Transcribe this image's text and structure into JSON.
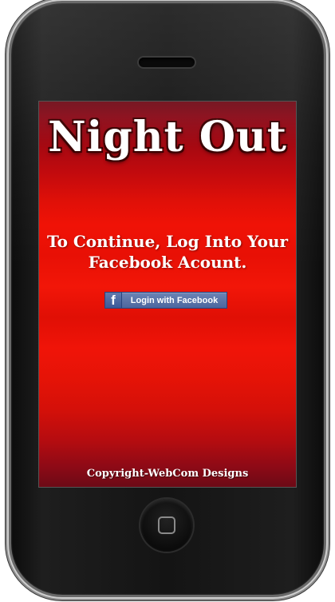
{
  "app": {
    "title": "Night Out"
  },
  "login": {
    "instruction": "To Continue, Log Into Your Facebook Acount.",
    "facebook_button": {
      "icon_letter": "f",
      "label": "Login with Facebook"
    }
  },
  "footer": {
    "copyright": "Copyright-WebCom Designs"
  },
  "colors": {
    "screen_top": "#6e0a16",
    "screen_mid": "#f01206",
    "screen_bottom": "#6c0a16",
    "facebook_blue": "#3b5998",
    "text": "#ffffff"
  },
  "icons": {
    "facebook": "facebook-f-icon",
    "home": "home-button-square-icon"
  }
}
